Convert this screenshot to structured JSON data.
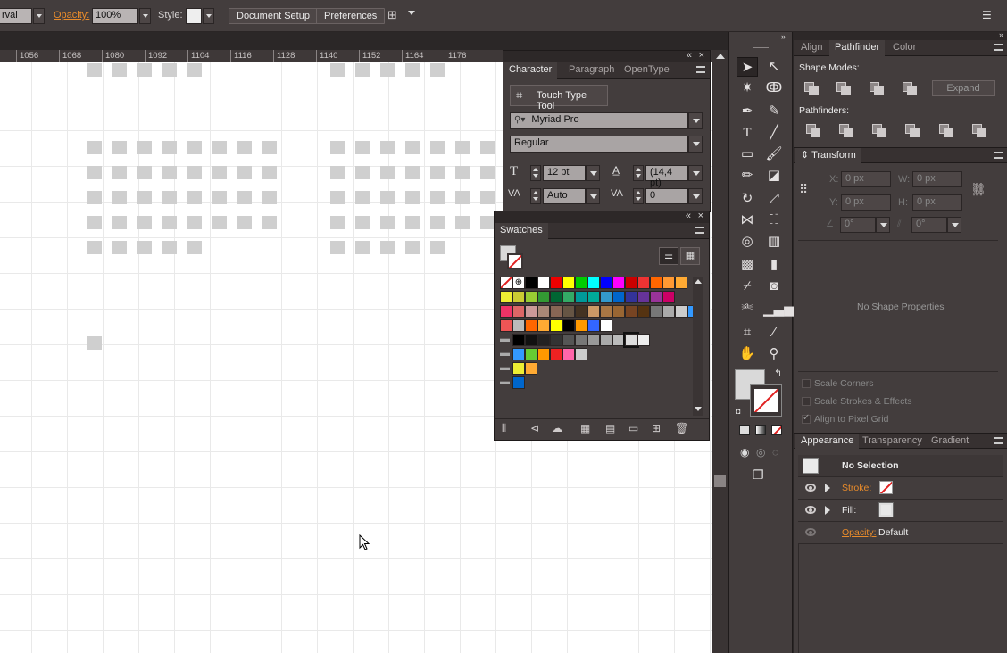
{
  "controlbar": {
    "variable_field": "rval",
    "opacity_label": "Opacity:",
    "opacity_value": "100%",
    "style_label": "Style:",
    "document_setup": "Document Setup",
    "preferences": "Preferences"
  },
  "ruler": {
    "ticks": [
      "1056",
      "1068",
      "1080",
      "1092",
      "1104",
      "1116",
      "1128",
      "1140",
      "1152",
      "1164",
      "1176"
    ]
  },
  "character_panel": {
    "tabs": [
      "Character",
      "Paragraph",
      "OpenType"
    ],
    "touch_type_tool": "Touch Type Tool",
    "font_family": "Myriad Pro",
    "font_style": "Regular",
    "font_size": "12 pt",
    "leading": "(14,4 pt)",
    "kerning": "Auto",
    "tracking": "0"
  },
  "swatches_panel": {
    "title": "Swatches"
  },
  "dock": {
    "tabs_top": [
      "Align",
      "Pathfinder",
      "Color"
    ],
    "shape_modes_label": "Shape Modes:",
    "expand_button": "Expand",
    "pathfinders_label": "Pathfinders:",
    "transform_tab": "Transform",
    "x_label": "X:",
    "x_value": "0 px",
    "y_label": "Y:",
    "y_value": "0 px",
    "w_label": "W:",
    "w_value": "0 px",
    "h_label": "H:",
    "h_value": "0 px",
    "angle_value": "0°",
    "shear_value": "0°",
    "no_shape_properties": "No Shape Properties",
    "scale_corners": "Scale Corners",
    "scale_strokes": "Scale Strokes & Effects",
    "align_pixel_grid": "Align to Pixel Grid",
    "appearance_tabs": [
      "Appearance",
      "Transparency",
      "Gradient"
    ],
    "no_selection": "No Selection",
    "stroke_label": "Stroke:",
    "fill_label": "Fill:",
    "opacity_label": "Opacity:",
    "opacity_value": "Default"
  },
  "colors": {
    "accent_orange": "#e88b2b",
    "ui_bg": "#433d3d"
  }
}
